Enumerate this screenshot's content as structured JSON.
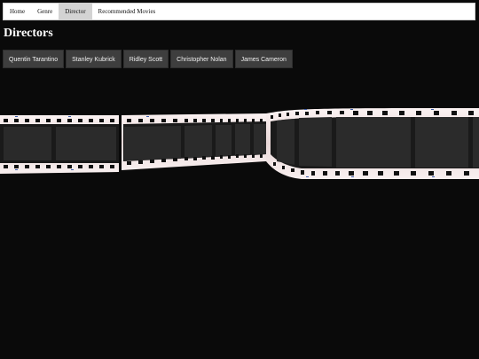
{
  "nav": {
    "items": [
      {
        "label": "Home",
        "active": false
      },
      {
        "label": "Genre",
        "active": false
      },
      {
        "label": "Director",
        "active": true
      },
      {
        "label": "Recommended Movies",
        "active": false
      }
    ]
  },
  "page": {
    "title": "Directors"
  },
  "directors": [
    "Quentin Tarantino",
    "Stanley Kubrick",
    "Ridley Scott",
    "Christopher Nolan",
    "James Cameron"
  ],
  "filmstrip": {
    "icon": "film-strip-illustration",
    "base_color": "#f2e6e6",
    "frame_color": "#1a1a1a"
  }
}
